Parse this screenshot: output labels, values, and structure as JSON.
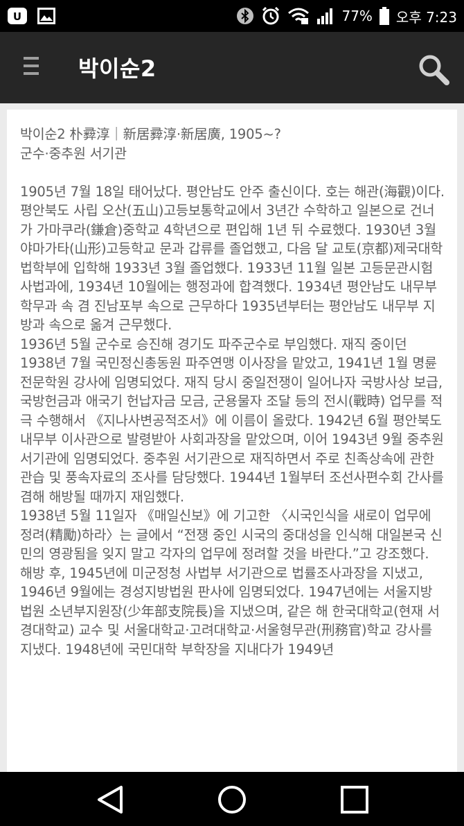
{
  "status_bar": {
    "battery_percent": "77%",
    "time": "오후 7:23",
    "icons": [
      "app-logo-icon",
      "gallery-icon",
      "bluetooth-icon",
      "alarm-icon",
      "wifi-icon",
      "signal-icon",
      "battery-icon"
    ]
  },
  "app_bar": {
    "title": "박이순2",
    "icons": [
      "menu-icon",
      "search-icon"
    ]
  },
  "article": {
    "heading_line1": "박이순2 朴彛淳｜新居彛淳·新居廣, 1905~?",
    "heading_line2": "군수·중추원 서기관",
    "paragraphs": [
      "1905년 7월 18일 태어났다. 평안남도 안주 출신이다. 호는 해관(海觀)이다. 평안북도 사립 오산(五山)고등보통학교에서 3년간 수학하고 일본으로 건너가 가마쿠라(鎌倉)중학교 4학년으로 편입해 1년 뒤 수료했다. 1930년 3월 야마가타(山形)고등학교 문과 갑류를 졸업했고, 다음 달 교토(京都)제국대학 법학부에 입학해 1933년 3월 졸업했다. 1933년 11월 일본 고등문관시험 사법과에, 1934년 10월에는 행정과에 합격했다. 1934년 평안남도 내무부 학무과 속 겸 진남포부 속으로 근무하다 1935년부터는 평안남도 내무부 지방과 속으로 옮겨 근무했다.",
      "1936년 5월 군수로 승진해 경기도 파주군수로 부임했다. 재직 중이던 1938년 7월 국민정신총동원 파주연맹 이사장을 맡았고, 1941년 1월 명륜전문학원 강사에 임명되었다. 재직 당시 중일전쟁이 일어나자 국방사상 보급, 국방헌금과 애국기 헌납자금 모금, 군용물자 조달 등의 전시(戰時) 업무를 적극 수행해서 《지나사변공적조서》에 이름이 올랐다. 1942년 6월 평안북도 내무부 이사관으로 발령받아 사회과장을 맡았으며, 이어 1943년 9월 중추원 서기관에 임명되었다. 중추원 서기관으로 재직하면서 주로 친족상속에 관한 관습 및 풍속자료의 조사를 담당했다. 1944년 1월부터 조선사편수회 간사를 겸해 해방될 때까지 재임했다.",
      "1938년 5월 11일자 《매일신보》에 기고한 〈시국인식을 새로이 업무에 정려(精勵)하라〉는 글에서 “전쟁 중인 시국의 중대성을 인식해 대일본국 신민의 영광됨을 잊지 말고 각자의 업무에 정려할 것을 바란다.”고 강조했다.",
      "해방 후, 1945년에 미군정청 사법부 서기관으로 법률조사과장을 지냈고, 1946년 9월에는 경성지방법원 판사에 임명되었다. 1947년에는 서울지방법원 소년부지원장(少年部支院長)을 지냈으며, 같은 해 한국대학교(현재 서경대학교) 교수 및 서울대학교·고려대학교·서울형무관(刑務官)학교 강사를 지냈다. 1948년에 국민대학 부학장을 지내다가 1949년"
    ]
  },
  "nav_bar": {
    "icons": [
      "back-icon",
      "home-icon",
      "recents-icon"
    ]
  }
}
